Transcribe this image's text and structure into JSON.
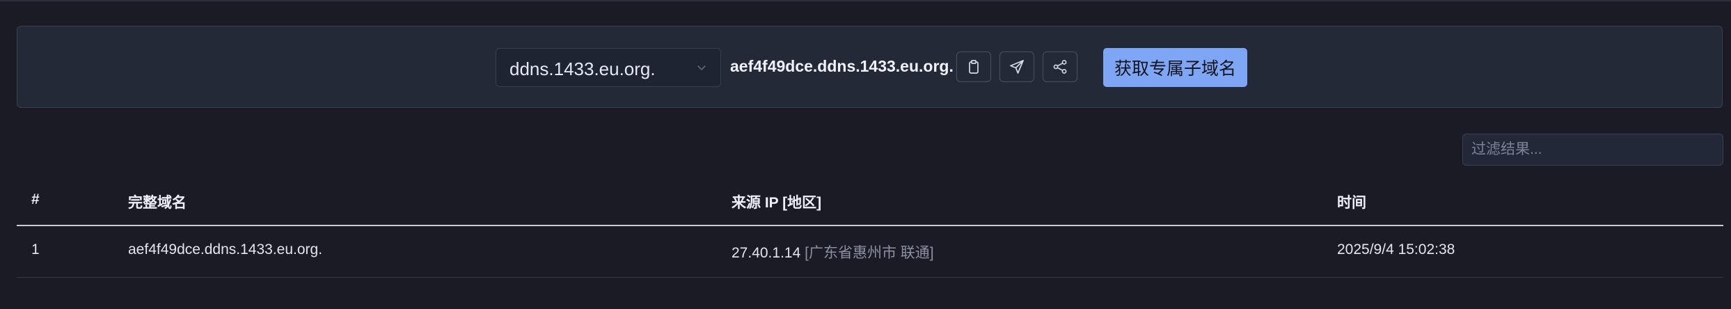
{
  "selector": {
    "selected_value": "ddns.1433.eu.org."
  },
  "generated_domain": "aef4f49dce.ddns.1433.eu.org.",
  "icons": {
    "copy": "clipboard-icon",
    "send": "send-icon",
    "share": "share-icon",
    "dropdown": "chevron-down-icon"
  },
  "primary_button": {
    "label": "获取专属子域名"
  },
  "filter": {
    "placeholder": "过滤结果..."
  },
  "table": {
    "headers": [
      "#",
      "完整域名",
      "来源 IP [地区]",
      "时间"
    ],
    "rows": [
      {
        "index": "1",
        "domain": "aef4f49dce.ddns.1433.eu.org.",
        "ip": "27.40.1.14",
        "region": "[广东省惠州市 联通]",
        "time": "2025/9/4 15:02:38"
      }
    ]
  },
  "colors": {
    "background": "#1b1b26",
    "panel": "#242938",
    "accent": "#7fa6f5"
  }
}
